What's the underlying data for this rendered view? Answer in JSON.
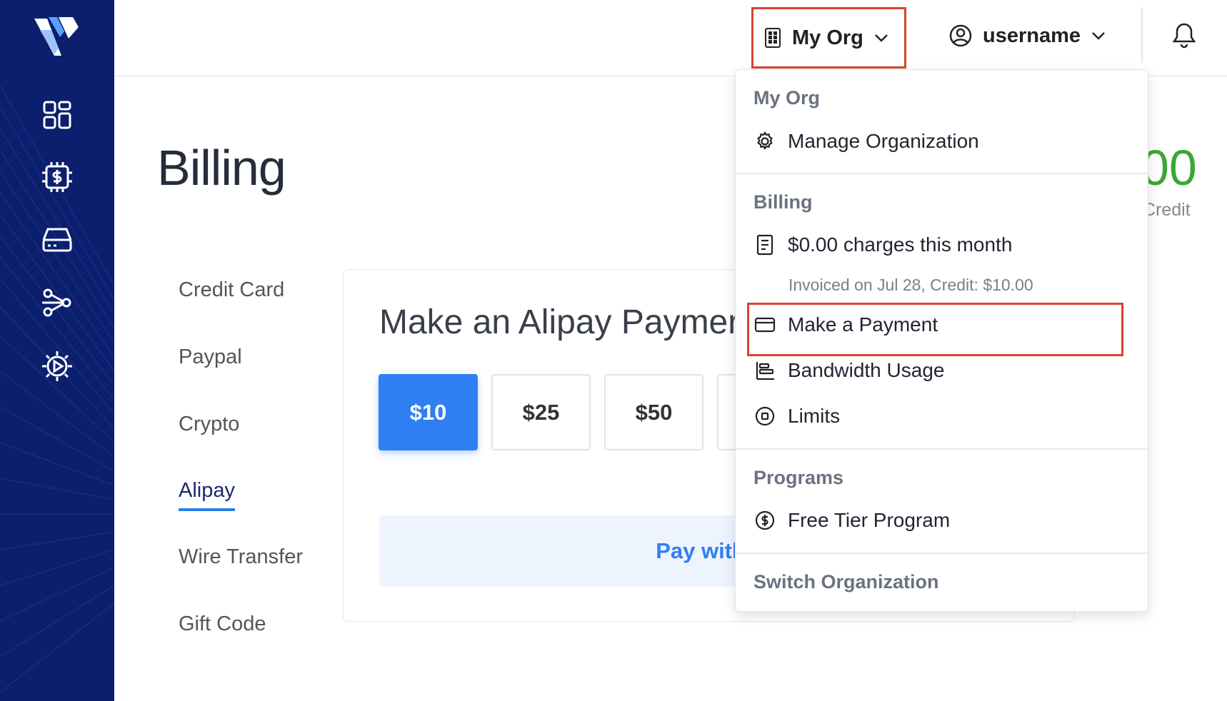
{
  "topbar": {
    "org_label": "My Org",
    "user_label": "username"
  },
  "page": {
    "title": "Billing",
    "credit_amount": "00",
    "credit_label": "Credit"
  },
  "tabs": [
    {
      "label": "Credit Card"
    },
    {
      "label": "Paypal"
    },
    {
      "label": "Crypto"
    },
    {
      "label": "Alipay"
    },
    {
      "label": "Wire Transfer"
    },
    {
      "label": "Gift Code"
    }
  ],
  "card": {
    "title": "Make an Alipay Paymer",
    "amounts": [
      "$10",
      "$25",
      "$50"
    ],
    "pay_label": "Pay with A"
  },
  "dropdown": {
    "org_section": "My Org",
    "manage_org": "Manage Organization",
    "billing_section": "Billing",
    "charges": "$0.00 charges this month",
    "invoice_note": "Invoiced on Jul 28, Credit: $10.00",
    "make_payment": "Make a Payment",
    "bandwidth": "Bandwidth Usage",
    "limits": "Limits",
    "programs_section": "Programs",
    "free_tier": "Free Tier Program",
    "switch_org": "Switch Organization"
  },
  "colors": {
    "sidebar": "#0b1f6e",
    "accent": "#2f7ff3",
    "highlight": "#d9432f",
    "credit": "#3aa835"
  }
}
